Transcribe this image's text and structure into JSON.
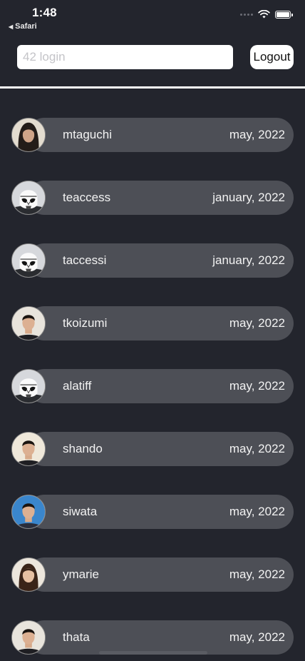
{
  "status_bar": {
    "time": "1:48",
    "back_app": "Safari"
  },
  "header": {
    "search_placeholder": "42 login",
    "search_value": "",
    "logout_label": "Logout"
  },
  "users": [
    {
      "login": "mtaguchi",
      "date": "may, 2022",
      "avatar": "long-hair-portrait"
    },
    {
      "login": "teaccess",
      "date": "january, 2022",
      "avatar": "stormtrooper"
    },
    {
      "login": "taccessi",
      "date": "january, 2022",
      "avatar": "stormtrooper"
    },
    {
      "login": "tkoizumi",
      "date": "may, 2022",
      "avatar": "short-hair-portrait"
    },
    {
      "login": "alatiff",
      "date": "may, 2022",
      "avatar": "stormtrooper"
    },
    {
      "login": "shando",
      "date": "may, 2022",
      "avatar": "short-hair-portrait"
    },
    {
      "login": "siwata",
      "date": "may, 2022",
      "avatar": "blue-background-portrait"
    },
    {
      "login": "ymarie",
      "date": "may, 2022",
      "avatar": "long-hair-portrait"
    },
    {
      "login": "thata",
      "date": "may, 2022",
      "avatar": "short-hair-portrait"
    }
  ],
  "colors": {
    "background": "#23252d",
    "row_pill": "#4d4f56",
    "text": "#ffffff"
  }
}
